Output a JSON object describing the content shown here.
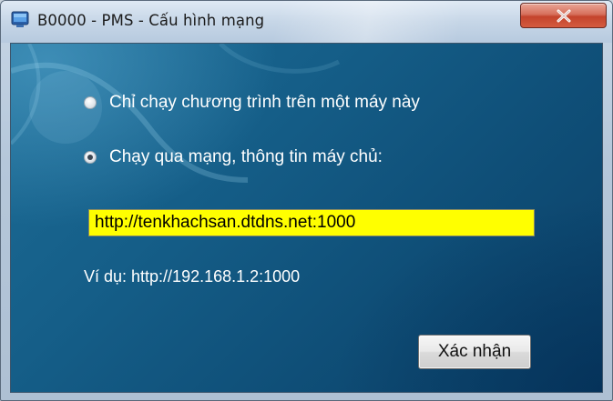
{
  "window": {
    "title": "B0000 - PMS - Cấu hình mạng",
    "close_label": "X"
  },
  "options": [
    {
      "label": "Chỉ chạy chương trình trên một máy này",
      "selected": false
    },
    {
      "label": "Chạy qua mạng, thông tin máy chủ:",
      "selected": true
    }
  ],
  "server": {
    "value": "http://tenkhachsan.dtdns.net:1000"
  },
  "example_text": "Ví dụ: http://192.168.1.2:1000",
  "confirm_label": "Xác nhận",
  "colors": {
    "input_background": "#ffff00",
    "panel_background": "#155e88",
    "close_button": "#c4432c"
  }
}
